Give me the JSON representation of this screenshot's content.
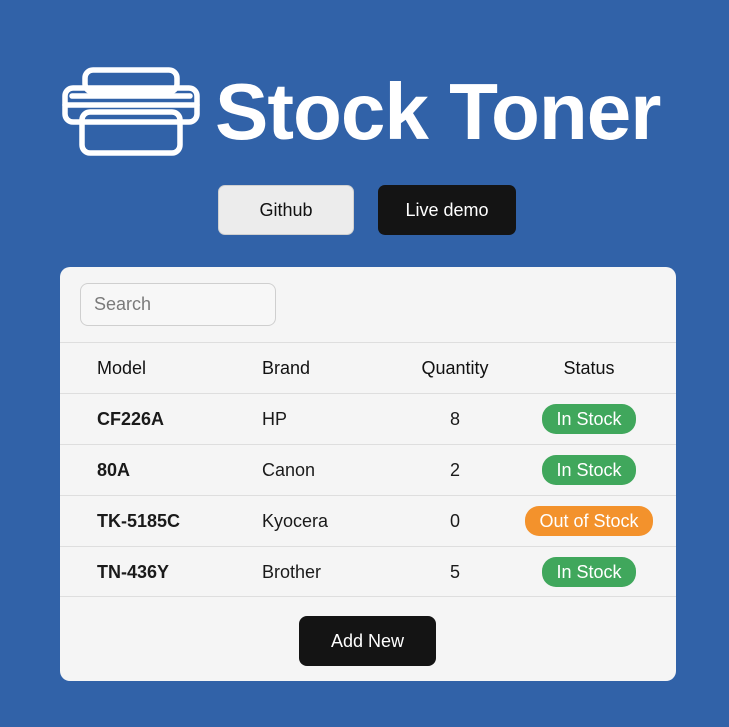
{
  "header": {
    "title": "Stock Toner",
    "logo_icon": "printer-icon"
  },
  "buttons": {
    "github": "Github",
    "live_demo": "Live demo",
    "add_new": "Add New"
  },
  "search": {
    "placeholder": "Search",
    "value": ""
  },
  "table": {
    "columns": [
      "Model",
      "Brand",
      "Quantity",
      "Status"
    ],
    "rows": [
      {
        "model": "CF226A",
        "brand": "HP",
        "quantity": "8",
        "status": "In Stock",
        "status_kind": "in"
      },
      {
        "model": "80A",
        "brand": "Canon",
        "quantity": "2",
        "status": "In Stock",
        "status_kind": "in"
      },
      {
        "model": "TK-5185C",
        "brand": "Kyocera",
        "quantity": "0",
        "status": "Out of Stock",
        "status_kind": "out"
      },
      {
        "model": "TN-436Y",
        "brand": "Brother",
        "quantity": "5",
        "status": "In Stock",
        "status_kind": "in"
      }
    ]
  },
  "colors": {
    "background": "#3162a8",
    "in_stock": "#40a75c",
    "out_of_stock": "#f3922c",
    "dark_button": "#141414"
  }
}
